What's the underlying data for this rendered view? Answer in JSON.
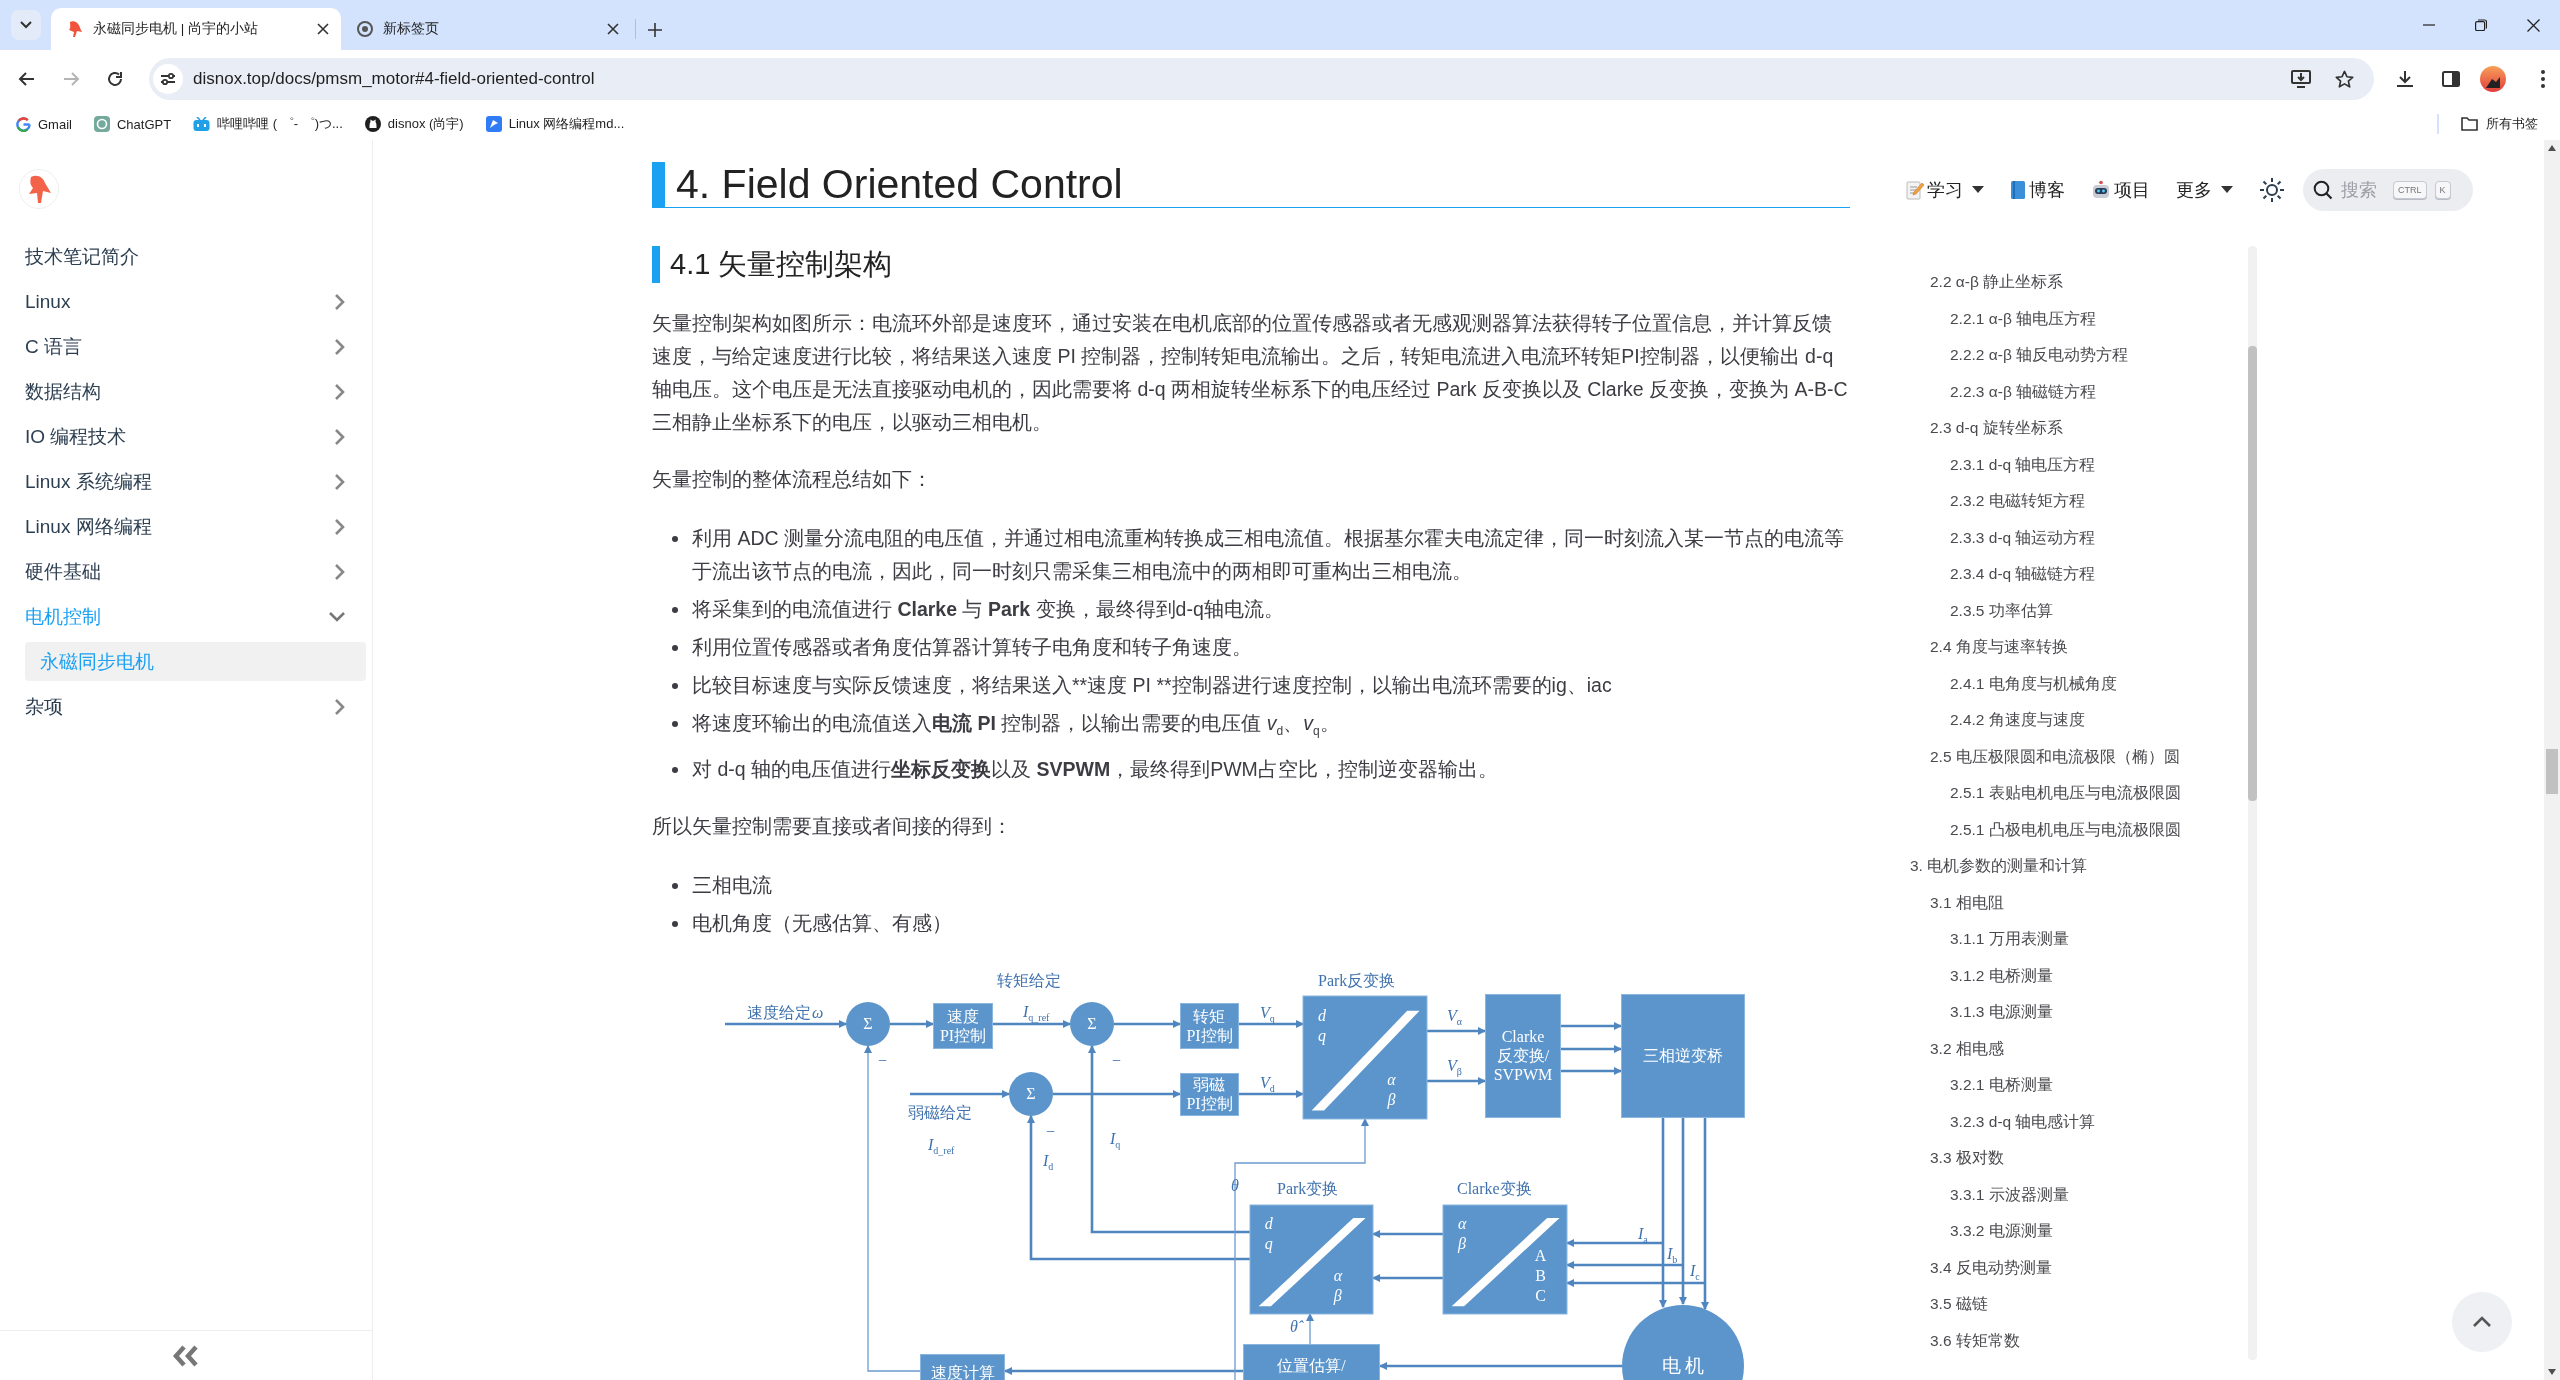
{
  "browser": {
    "tabs": [
      {
        "title": "永磁同步电机 | 尚宇的小站",
        "selected": true
      },
      {
        "title": "新标签页",
        "selected": false
      }
    ],
    "back": {
      "disabled": false
    },
    "forward": {
      "disabled": true
    },
    "address": "disnox.top/docs/pmsm_motor#4-field-oriented-control",
    "bookmarks": [
      {
        "label": "Gmail"
      },
      {
        "label": "ChatGPT"
      },
      {
        "label": "哔哩哔哩 ( ゜- ゜)つ..."
      },
      {
        "label": "disnox (尚宇)"
      },
      {
        "label": "Linux 网络编程md..."
      }
    ],
    "all_bookmarks": "所有书签"
  },
  "sidebar": {
    "items": [
      {
        "label": "技术笔记简介",
        "active": false
      },
      {
        "label": "Linux",
        "expanded": false,
        "active": false
      },
      {
        "label": "C 语言",
        "expanded": false,
        "active": false
      },
      {
        "label": "数据结构",
        "expanded": false,
        "active": false
      },
      {
        "label": "IO 编程技术",
        "expanded": false,
        "active": false
      },
      {
        "label": "Linux 系统编程",
        "expanded": false,
        "active": false
      },
      {
        "label": "Linux 网络编程",
        "expanded": false,
        "active": false
      },
      {
        "label": "硬件基础",
        "expanded": false,
        "active": false
      },
      {
        "label": "电机控制",
        "expanded": true,
        "active": true,
        "children": [
          {
            "label": "永磁同步电机",
            "selected": true
          }
        ]
      },
      {
        "label": "杂项",
        "expanded": false,
        "active": false
      }
    ]
  },
  "article": {
    "title": "4. Field Oriented Control",
    "section": "4.1 矢量控制架构",
    "blocks": [
      {
        "kind": "paragraph",
        "text": "矢量控制架构如图所示：电流环外部是速度环，通过安装在电机底部的位置传感器或者无感观测器算法获得转子位置信息，并计算反馈速度，与给定速度进行比较，将结果送入速度 PI 控制器，控制转矩电流输出。之后，转矩电流进入电流环转矩PI控制器，以便输出 d-q 轴电压。这个电压是无法直接驱动电机的，因此需要将 d-q 两相旋转坐标系下的电压经过 Park 反变换以及 Clarke 反变换，变换为 A-B-C 三相静止坐标系下的电压，以驱动三相电机。"
      },
      {
        "kind": "paragraph",
        "text": "矢量控制的整体流程总结如下："
      },
      {
        "kind": "list",
        "items": [
          {
            "kind": "rich",
            "text": "利用 ADC 测量分流电阻的电压值，并通过相电流重构转换成三相电流值。根据基尔霍夫电流定律，同一时刻流入某一节点的电流等于流出该节点的电流，因此，同一时刻只需采集三相电流中的两相即可重构出三相电流。"
          },
          {
            "kind": "rich",
            "text": "将采集到的电流值进行 **Clarke** 与 **Park** 变换，最终得到d-q轴电流。"
          },
          {
            "kind": "rich",
            "text": "利用位置传感器或者角度估算器计算转子电角度和转子角速度。"
          },
          {
            "kind": "plain",
            "text": "比较目标速度与实际反馈速度，将结果送入**速度 PI **控制器进行速度控制，以输出电流环需要的ig、iac"
          },
          {
            "kind": "rich",
            "text": "将速度环输出的电流值送入**电流 PI** 控制器，以输出需要的电压值 *v*$_{d}$、*v*$_{q}$。"
          },
          {
            "kind": "rich",
            "text": "对 d-q 轴的电压值进行**坐标反变换**以及 **SVPWM**，最终得到PWM占空比，控制逆变器输出。"
          }
        ]
      },
      {
        "kind": "paragraph",
        "text": "所以矢量控制需要直接或者间接的得到："
      },
      {
        "kind": "list",
        "items": [
          {
            "kind": "rich",
            "text": "三相电流"
          },
          {
            "kind": "rich",
            "text": "电机角度（无感估算、有感）"
          }
        ]
      },
      {
        "kind": "figure",
        "diagram": {
          "sums": [
            "Σ",
            "Σ",
            "Σ"
          ],
          "blocks": [
            {
              "kind": "controller",
              "lines": [
                "速度",
                "PI控制"
              ]
            },
            {
              "kind": "controller",
              "lines": [
                "转矩",
                "PI控制"
              ]
            },
            {
              "kind": "controller",
              "lines": [
                "弱磁",
                "PI控制"
              ]
            },
            {
              "kind": "transform",
              "axes": [
                "*d*",
                "*q*",
                "*α*",
                "*β*"
              ]
            },
            {
              "kind": "controller",
              "lines": [
                "Clarke",
                "反变换/",
                "SVPWM"
              ]
            },
            {
              "kind": "controller",
              "lines": [
                "三相逆变桥"
              ]
            },
            {
              "kind": "transform",
              "axes": [
                "*d*",
                "*q*",
                "*α*",
                "*β*"
              ]
            },
            {
              "kind": "transform",
              "axes": [
                "*α*",
                "*β*",
                "A",
                "B",
                "C"
              ]
            },
            {
              "kind": "controller",
              "lines": [
                "速度计算"
              ]
            },
            {
              "kind": "controller",
              "lines": [
                "位置估算/"
              ]
            },
            {
              "kind": "motor",
              "lines": [
                "电 机"
              ]
            }
          ],
          "labels": [
            "速度给定",
            "转矩给定",
            "*I*$_{q_ref}$",
            "*V*$_{q}$",
            "Park反变换",
            "*V*$_{α}$",
            "*V*$_{β}$",
            "弱磁给定",
            "*I*$_{d_ref}$",
            "*V*$_{d}$",
            "−",
            "−",
            "−",
            "*I*$_{q}$",
            "*I*$_{d}$",
            "*θ*",
            "Park变换",
            "Clarke变换",
            "*I*$_{a}$",
            "*I*$_{b}$",
            "*I*$_{c}$",
            "*θ̂*",
            "*ω*"
          ]
        }
      }
    ]
  },
  "header_nav": {
    "items": [
      {
        "label": "学习",
        "dropdown": true
      },
      {
        "label": "博客",
        "dropdown": false
      },
      {
        "label": "项目",
        "dropdown": false
      },
      {
        "label": "更多",
        "dropdown": true
      }
    ],
    "search": {
      "placeholder": "搜索",
      "keys": [
        "CTRL",
        "K"
      ]
    }
  },
  "toc": {
    "items": [
      {
        "children": [
          {
            "label": "2.2 α-β 静止坐标系",
            "children": [
              {
                "label": "2.2.1 α-β 轴电压方程"
              },
              {
                "label": "2.2.2 α-β 轴反电动势方程"
              },
              {
                "label": "2.2.3 α-β 轴磁链方程"
              }
            ]
          },
          {
            "label": "2.3 d-q 旋转坐标系",
            "children": [
              {
                "label": "2.3.1 d-q 轴电压方程"
              },
              {
                "label": "2.3.2 电磁转矩方程"
              },
              {
                "label": "2.3.3 d-q 轴运动方程"
              },
              {
                "label": "2.3.4 d-q 轴磁链方程"
              },
              {
                "label": "2.3.5 功率估算"
              }
            ]
          },
          {
            "label": "2.4 角度与速率转换",
            "children": [
              {
                "label": "2.4.1 电角度与机械角度"
              },
              {
                "label": "2.4.2 角速度与速度"
              }
            ]
          },
          {
            "label": "2.5 电压极限圆和电流极限（椭）圆",
            "children": [
              {
                "label": "2.5.1 表贴电机电压与电流极限圆"
              },
              {
                "label": "2.5.1 凸极电机电压与电流极限圆"
              }
            ]
          }
        ]
      },
      {
        "label": "3. 电机参数的测量和计算",
        "children": [
          {
            "label": "3.1 相电阻",
            "children": [
              {
                "label": "3.1.1 万用表测量"
              },
              {
                "label": "3.1.2 电桥测量"
              },
              {
                "label": "3.1.3 电源测量"
              }
            ]
          },
          {
            "label": "3.2 相电感",
            "children": [
              {
                "label": "3.2.1 电桥测量"
              },
              {
                "label": "3.2.3 d-q 轴电感计算"
              }
            ]
          },
          {
            "label": "3.3 极对数",
            "children": [
              {
                "label": "3.3.1 示波器测量"
              },
              {
                "label": "3.3.2 电源测量"
              }
            ]
          },
          {
            "label": "3.4 反电动势测量"
          },
          {
            "label": "3.5 磁链"
          },
          {
            "label": "3.6 转矩常数"
          }
        ]
      }
    ]
  }
}
